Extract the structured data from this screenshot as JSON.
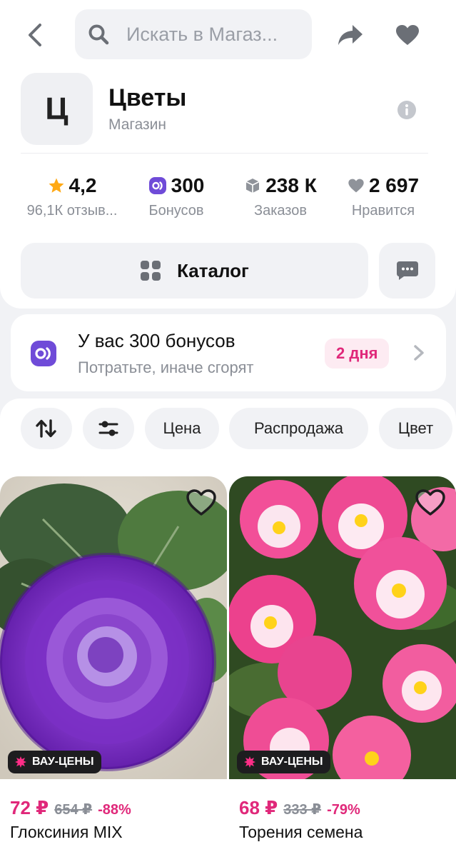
{
  "header": {
    "search_placeholder": "Искать в Магаз..."
  },
  "shop": {
    "logo_letter": "Ц",
    "name": "Цветы",
    "type": "Магазин"
  },
  "stats": [
    {
      "value": "4,2",
      "label": "96,1К отзыв...",
      "icon": "star-icon"
    },
    {
      "value": "300",
      "label": "Бонусов",
      "icon": "bonus-icon"
    },
    {
      "value": "238 К",
      "label": "Заказов",
      "icon": "box-icon"
    },
    {
      "value": "2 697",
      "label": "Нравится",
      "icon": "heart-icon"
    }
  ],
  "catalog": {
    "label": "Каталог"
  },
  "bonus_banner": {
    "title": "У вас 300 бонусов",
    "subtitle": "Потратьте, иначе сгорят",
    "badge": "2 дня"
  },
  "filters": [
    "Цена",
    "Распродажа",
    "Цвет"
  ],
  "products": [
    {
      "badge": "ВАУ-ЦЕНЫ",
      "price": "72 ₽",
      "old_price": "654 ₽",
      "discount": "-88%",
      "name": "Глоксиния MIX"
    },
    {
      "badge": "ВАУ-ЦЕНЫ",
      "price": "68 ₽",
      "old_price": "333 ₽",
      "discount": "-79%",
      "name": "Торения семена"
    }
  ],
  "colors": {
    "accent": "#e0287a",
    "bonus_purple": "#6f4bd8",
    "muted": "#8a8e96",
    "surface": "#f1f2f5"
  }
}
